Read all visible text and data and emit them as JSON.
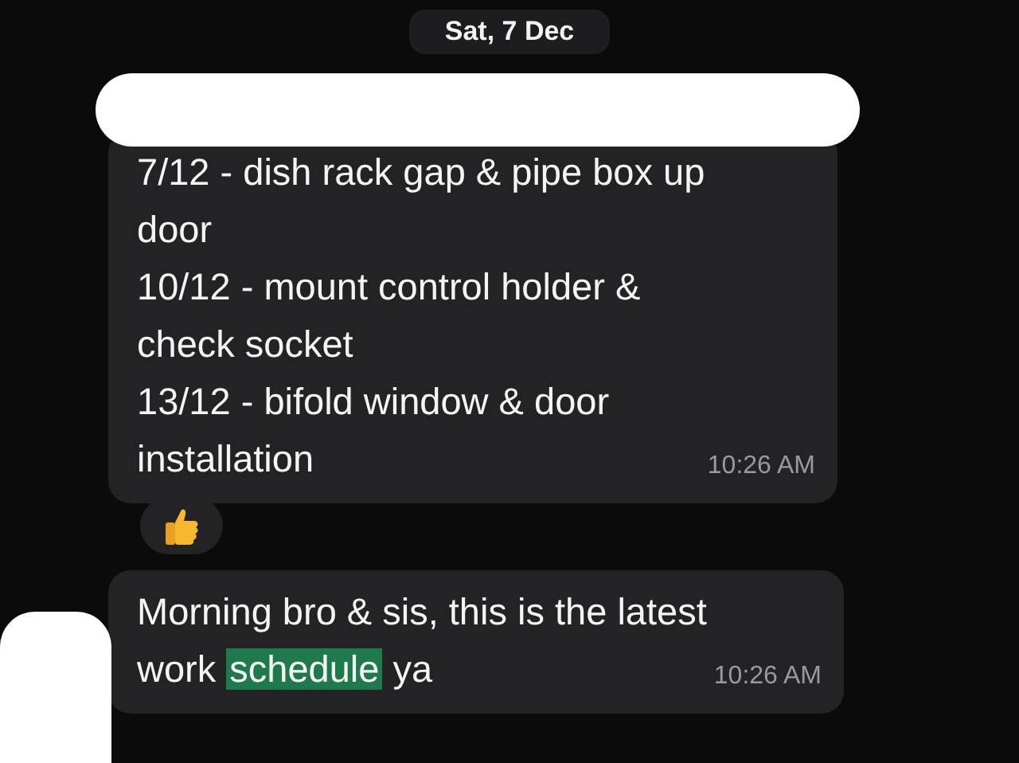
{
  "date_chip": "Sat, 7 Dec",
  "messages": [
    {
      "kind": "text",
      "redacted_header": true,
      "lines": [
        "7/12 - dish rack gap & pipe box up",
        "door",
        "10/12 - mount control holder &",
        "check socket",
        "13/12 - bifold window & door",
        "installation"
      ],
      "time": "10:26 AM",
      "reaction": {
        "kind": "thumbs_up"
      }
    },
    {
      "kind": "highlighted",
      "redacted_avatar": true,
      "lines": [
        [
          {
            "text": "Morning bro & sis, this is the latest",
            "highlighted": false
          }
        ],
        [
          {
            "text": "work ",
            "highlighted": false
          },
          {
            "text": "schedule",
            "highlighted": true
          },
          {
            "text": " ya",
            "highlighted": false
          }
        ]
      ],
      "time": "10:26 AM"
    }
  ]
}
